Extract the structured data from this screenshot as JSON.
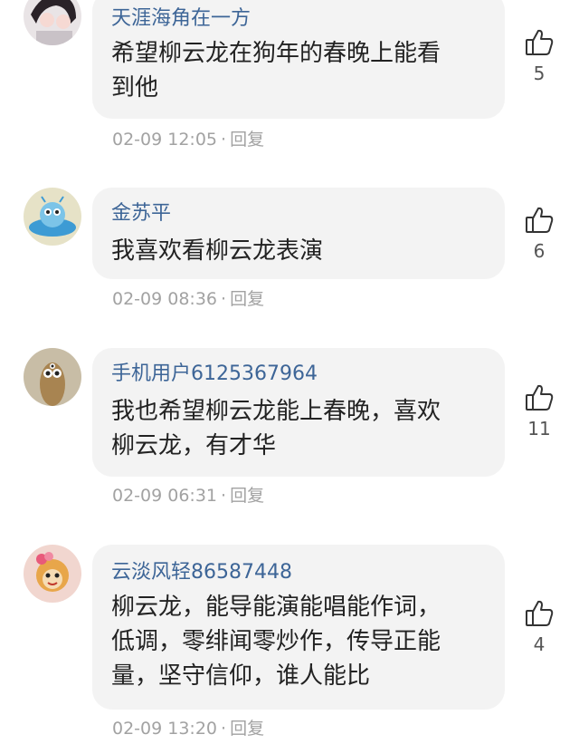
{
  "comments": [
    {
      "username": "天涯海角在一方",
      "lines": [
        "希望柳云龙在狗年的春晚上能看",
        "到他"
      ],
      "time": "02-09 12:05",
      "dot": "·",
      "reply": "回复",
      "likes": "5",
      "avatar": "avatar-anime"
    },
    {
      "username": "金苏平",
      "lines": [
        "我喜欢看柳云龙表演"
      ],
      "time": "02-09 08:36",
      "dot": "·",
      "reply": "回复",
      "likes": "6",
      "avatar": "avatar-alien-ufo"
    },
    {
      "username": "手机用户6125367964",
      "lines": [
        "我也希望柳云龙能上春晚，喜欢",
        "柳云龙，有才华"
      ],
      "time": "02-09 06:31",
      "dot": "·",
      "reply": "回复",
      "likes": "11",
      "avatar": "avatar-sausage-character"
    },
    {
      "username": "云淡风轻86587448",
      "lines": [
        "柳云龙，能导能演能唱能作词，",
        "低调，零绯闻零炒作，传导正能",
        "量，坚守信仰，谁人能比"
      ],
      "time": "02-09 13:20",
      "dot": "·",
      "reply": "回复",
      "likes": "4",
      "avatar": "avatar-monkey-character"
    }
  ],
  "colors": {
    "username": "#3d6597",
    "bubble": "#f3f3f3",
    "meta": "#a2a2a2"
  }
}
